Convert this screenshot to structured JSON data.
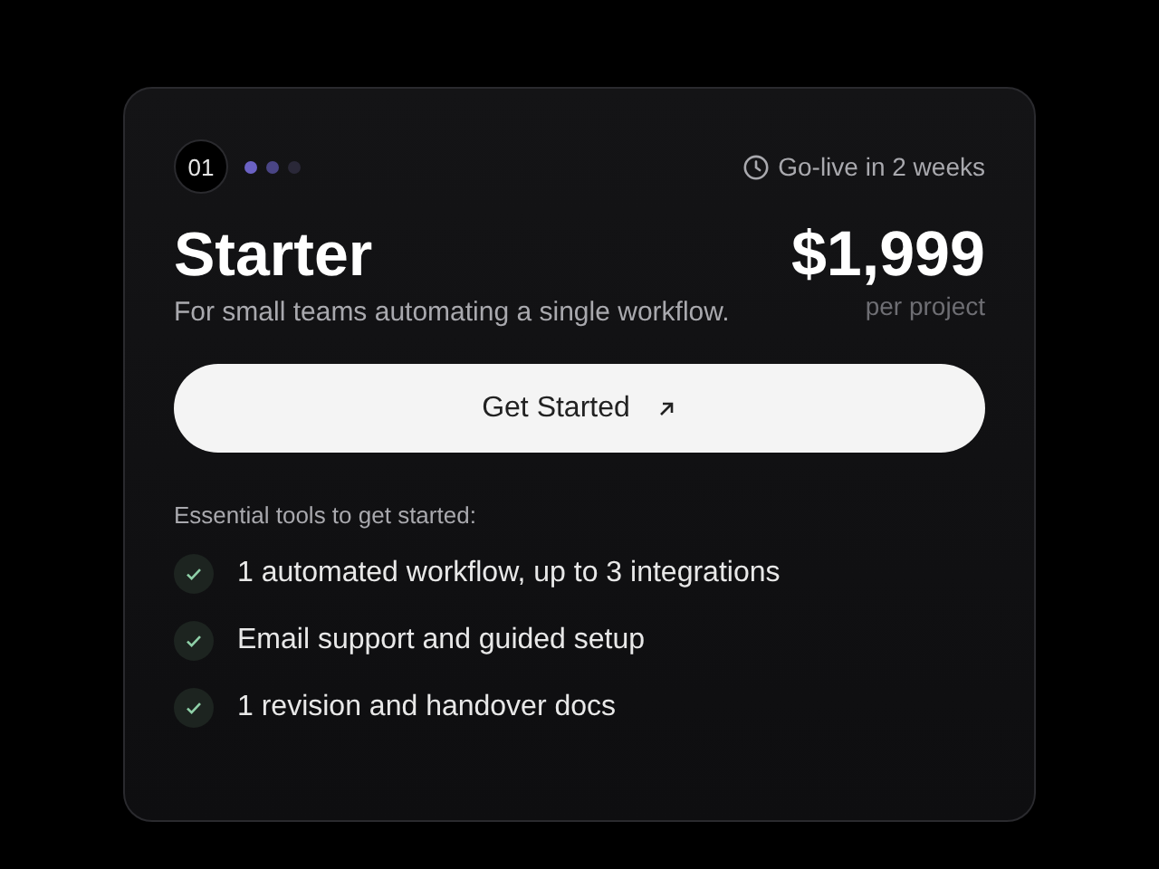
{
  "plan": {
    "number": "01",
    "dots": [
      {
        "color": "#6b62c4"
      },
      {
        "color": "#4a4585"
      },
      {
        "color": "#2a2838"
      }
    ],
    "timeline": "Go-live in 2 weeks",
    "name": "Starter",
    "description": "For small teams automating a single workflow.",
    "price": "$1,999",
    "price_unit": "per project",
    "button": {
      "label": "Get Started"
    },
    "features_heading": "Essential tools to get started:",
    "features": [
      {
        "text": "1 automated workflow, up to 3 integrations",
        "checked": true
      },
      {
        "text": "Email support and guided setup",
        "checked": true
      },
      {
        "text": "1 revision and handover docs",
        "checked": true
      }
    ]
  }
}
